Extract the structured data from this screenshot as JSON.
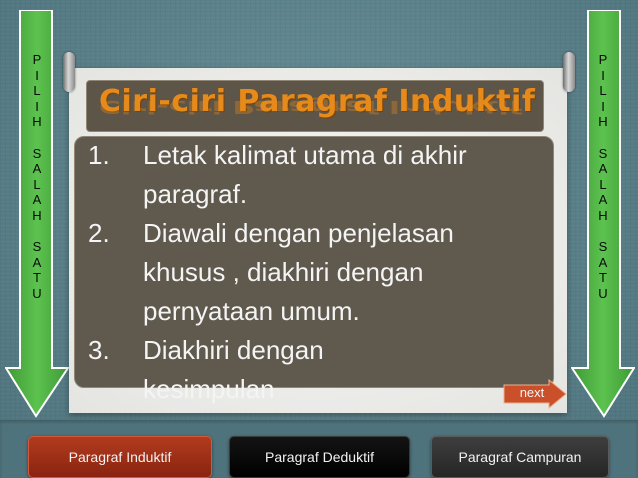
{
  "side_arrows": {
    "left_letters": [
      "P",
      "I",
      "L",
      "I",
      "H",
      "",
      "S",
      "A",
      "L",
      "A",
      "H",
      "",
      "S",
      "A",
      "T",
      "U"
    ],
    "right_letters": [
      "P",
      "I",
      "L",
      "I",
      "H",
      "",
      "S",
      "A",
      "L",
      "A",
      "H",
      "",
      "S",
      "A",
      "T",
      "U"
    ],
    "color": "#4db043"
  },
  "slide": {
    "title": "Ciri-ciri Paragraf Induktif",
    "items": [
      {
        "num": "1.",
        "line1": "Letak kalimat utama di akhir",
        "line2": "paragraf."
      },
      {
        "num": "2.",
        "line1": "Diawali dengan penjelasan",
        "line2": "khusus , diakhiri dengan",
        "line3": "pernyataan umum."
      },
      {
        "num": "3.",
        "line1": "Diakhiri dengan",
        "line2": "kesimpulan"
      }
    ],
    "next_label": "next"
  },
  "nav": {
    "induktif": "Paragraf Induktif",
    "deduktif": "Paragraf Deduktif",
    "campuran": "Paragraf Campuran"
  },
  "colors": {
    "title": "#e68a1c",
    "content_bg": "#5f594e",
    "next_arrow": "#c9502a"
  }
}
